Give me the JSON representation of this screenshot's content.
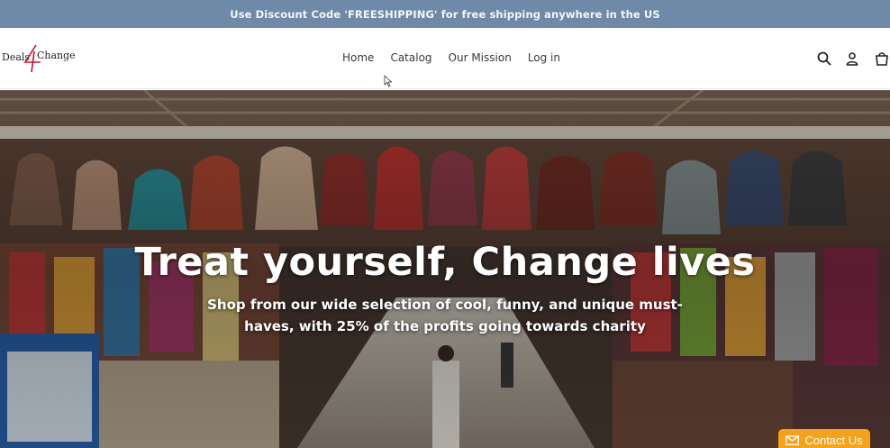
{
  "announcement": {
    "text": "Use Discount Code 'FREESHIPPING' for free shipping anywhere in the US"
  },
  "logo": {
    "word1": "Deals",
    "numeral": "4",
    "word2": "Change"
  },
  "nav": {
    "items": [
      {
        "label": "Home"
      },
      {
        "label": "Catalog"
      },
      {
        "label": "Our Mission"
      },
      {
        "label": "Log in"
      }
    ]
  },
  "header_icons": {
    "search": "search-icon",
    "account": "account-icon",
    "cart": "cart-icon"
  },
  "hero": {
    "title": "Treat yourself, Change lives",
    "subtitle": "Shop from our wide selection of cool, funny, and unique must-haves, with 25% of the profits going towards charity"
  },
  "contact": {
    "label": "Contact Us",
    "icon": "mail-icon"
  },
  "colors": {
    "announce_bg": "#6e8aa8",
    "accent": "#f7a21b"
  }
}
